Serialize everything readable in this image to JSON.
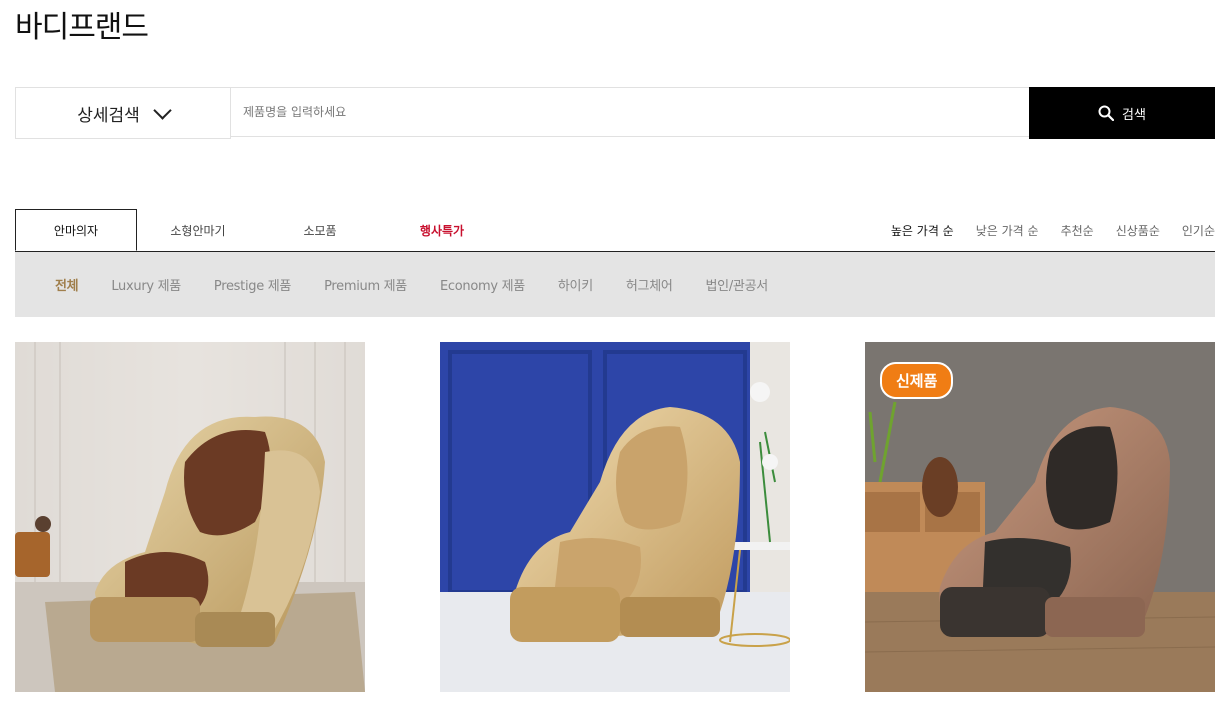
{
  "brand": {
    "title": "바디프랜드"
  },
  "search": {
    "advanced_label": "상세검색",
    "placeholder": "제품명을 입력하세요",
    "value": "",
    "button_label": "검색"
  },
  "tabs": [
    {
      "label": "안마의자"
    },
    {
      "label": "소형안마기"
    },
    {
      "label": "소모품"
    },
    {
      "label": "행사특가"
    }
  ],
  "sort": [
    {
      "label": "높은 가격 순"
    },
    {
      "label": "낮은 가격 순"
    },
    {
      "label": "추천순"
    },
    {
      "label": "신상품순"
    },
    {
      "label": "인기순"
    }
  ],
  "subcategories": [
    {
      "label": "전체"
    },
    {
      "label": "Luxury 제품"
    },
    {
      "label": "Prestige 제품"
    },
    {
      "label": "Premium 제품"
    },
    {
      "label": "Economy 제품"
    },
    {
      "label": "하이키"
    },
    {
      "label": "허그체어"
    },
    {
      "label": "법인/관공서"
    }
  ],
  "products": [
    {
      "badge": ""
    },
    {
      "badge": ""
    },
    {
      "badge": "신제품"
    }
  ],
  "colors": {
    "accent": "#000000",
    "promo": "#c8102e",
    "active_sub": "#a07f4c",
    "badge": "#f07d14"
  }
}
